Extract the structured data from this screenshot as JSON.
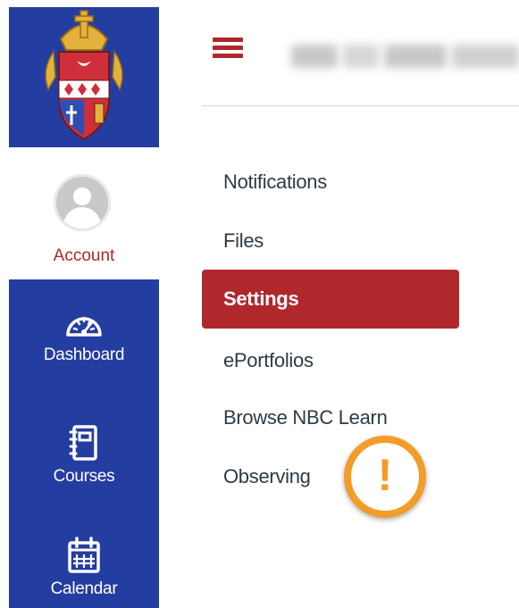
{
  "account": {
    "label": "Account"
  },
  "nav": [
    {
      "label": "Dashboard",
      "icon": "dashboard-icon"
    },
    {
      "label": "Courses",
      "icon": "courses-icon"
    },
    {
      "label": "Calendar",
      "icon": "calendar-icon"
    }
  ],
  "header": {
    "menu_icon": "hamburger-icon"
  },
  "menu": [
    {
      "label": "Notifications",
      "active": false
    },
    {
      "label": "Files",
      "active": false
    },
    {
      "label": "Settings",
      "active": true
    },
    {
      "label": "ePortfolios",
      "active": false
    },
    {
      "label": "Browse NBC Learn",
      "active": false
    },
    {
      "label": "Observing",
      "active": false
    }
  ],
  "warning": {
    "symbol": "!",
    "icon": "warning-icon"
  },
  "colors": {
    "sidebar_blue": "#243da1",
    "accent_red": "#b0282c",
    "warning_orange": "#f39c27",
    "text_dark": "#2d3b45"
  }
}
